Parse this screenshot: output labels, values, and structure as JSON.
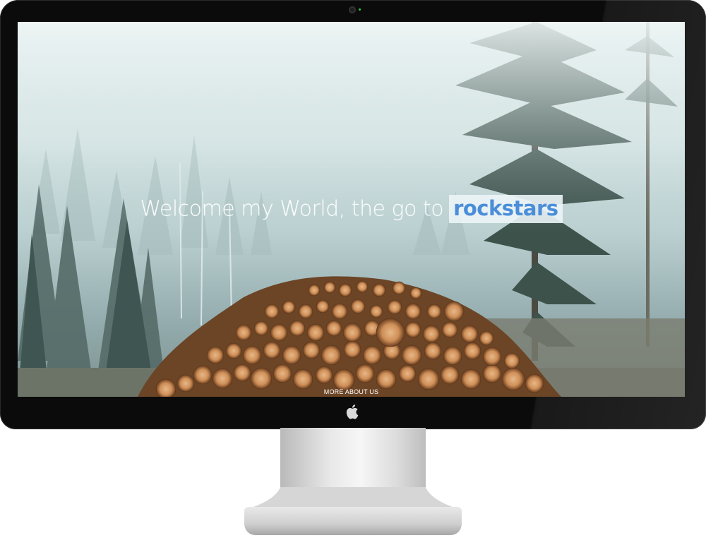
{
  "hero": {
    "text_before": "Welcome my World, the go to",
    "text_highlight": "rockstars"
  },
  "cta": {
    "label": "MORE ABOUT US"
  },
  "colors": {
    "highlight_text": "#4a8ed9",
    "bezel": "#0b0b0b"
  },
  "icons": {
    "brand_logo": "apple-logo-icon",
    "camera": "camera-icon"
  }
}
